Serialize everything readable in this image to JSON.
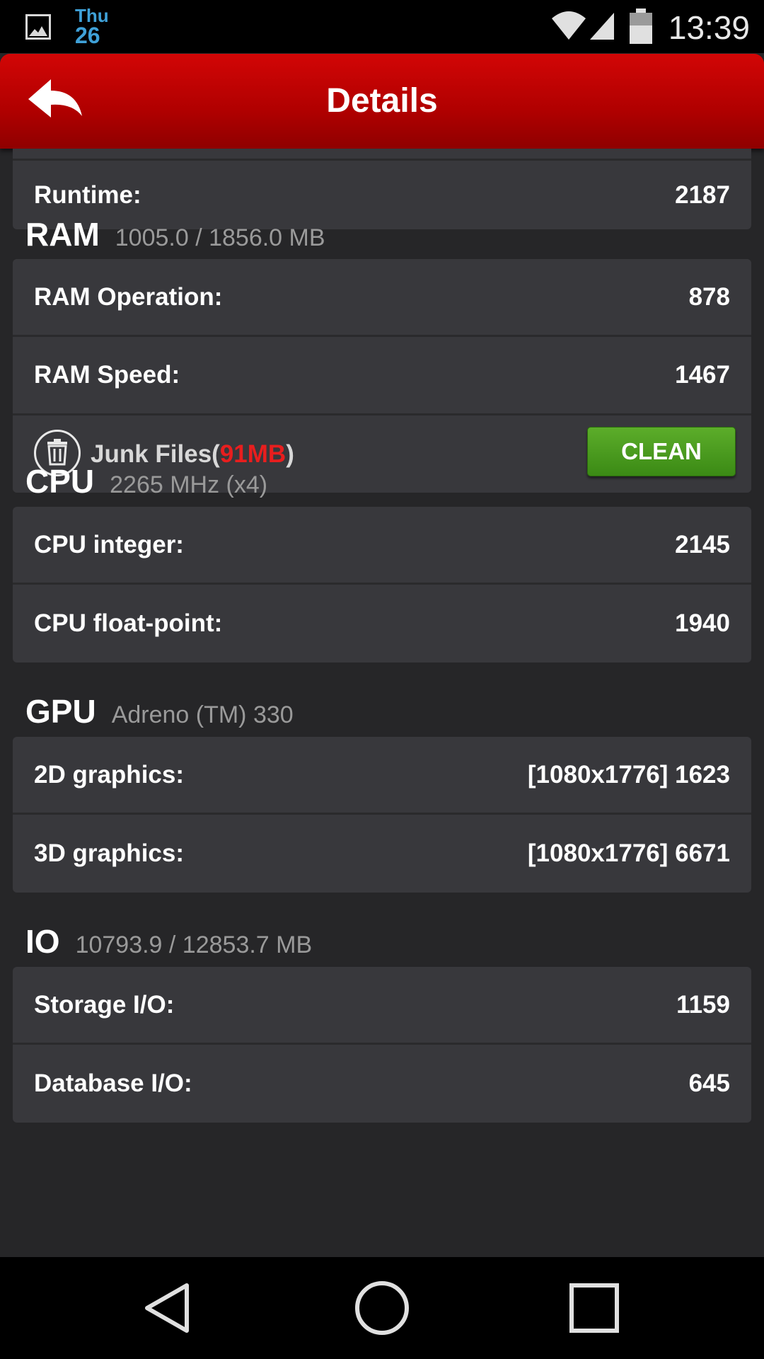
{
  "status_bar": {
    "day": "Thu",
    "date": "26",
    "time": "13:39",
    "icons": [
      "gallery-icon",
      "wifi-icon",
      "signal-icon",
      "battery-icon"
    ]
  },
  "header": {
    "title": "Details",
    "back_icon": "back-arrow-icon"
  },
  "top_partial": {
    "label": "Runtime:",
    "value": "2187"
  },
  "ram": {
    "title": "RAM",
    "subtitle": "1005.0 / 1856.0 MB",
    "rows": [
      {
        "label": "RAM Operation:",
        "value": "878"
      },
      {
        "label": "RAM Speed:",
        "value": "1467"
      }
    ],
    "junk": {
      "label_prefix": "Junk Files(",
      "size": "91MB",
      "label_suffix": ")",
      "button": "CLEAN",
      "icon": "trash-icon"
    }
  },
  "cpu": {
    "title": "CPU",
    "subtitle": "2265 MHz (x4)",
    "rows": [
      {
        "label": "CPU integer:",
        "value": "2145"
      },
      {
        "label": "CPU float-point:",
        "value": "1940"
      }
    ]
  },
  "gpu": {
    "title": "GPU",
    "subtitle": "Adreno (TM) 330",
    "rows": [
      {
        "label": "2D graphics:",
        "value": "[1080x1776] 1623"
      },
      {
        "label": "3D graphics:",
        "value": "[1080x1776] 6671"
      }
    ]
  },
  "io": {
    "title": "IO",
    "subtitle": "10793.9 / 12853.7 MB",
    "rows": [
      {
        "label": "Storage I/O:",
        "value": "1159"
      },
      {
        "label": "Database I/O:",
        "value": "645"
      }
    ]
  },
  "nav": {
    "icons": [
      "nav-back-icon",
      "nav-home-icon",
      "nav-recents-icon"
    ]
  },
  "colors": {
    "header_red": "#c00000",
    "accent_blue": "#3fa1d8",
    "junk_red": "#e81e1e",
    "clean_green": "#4c9c20"
  }
}
